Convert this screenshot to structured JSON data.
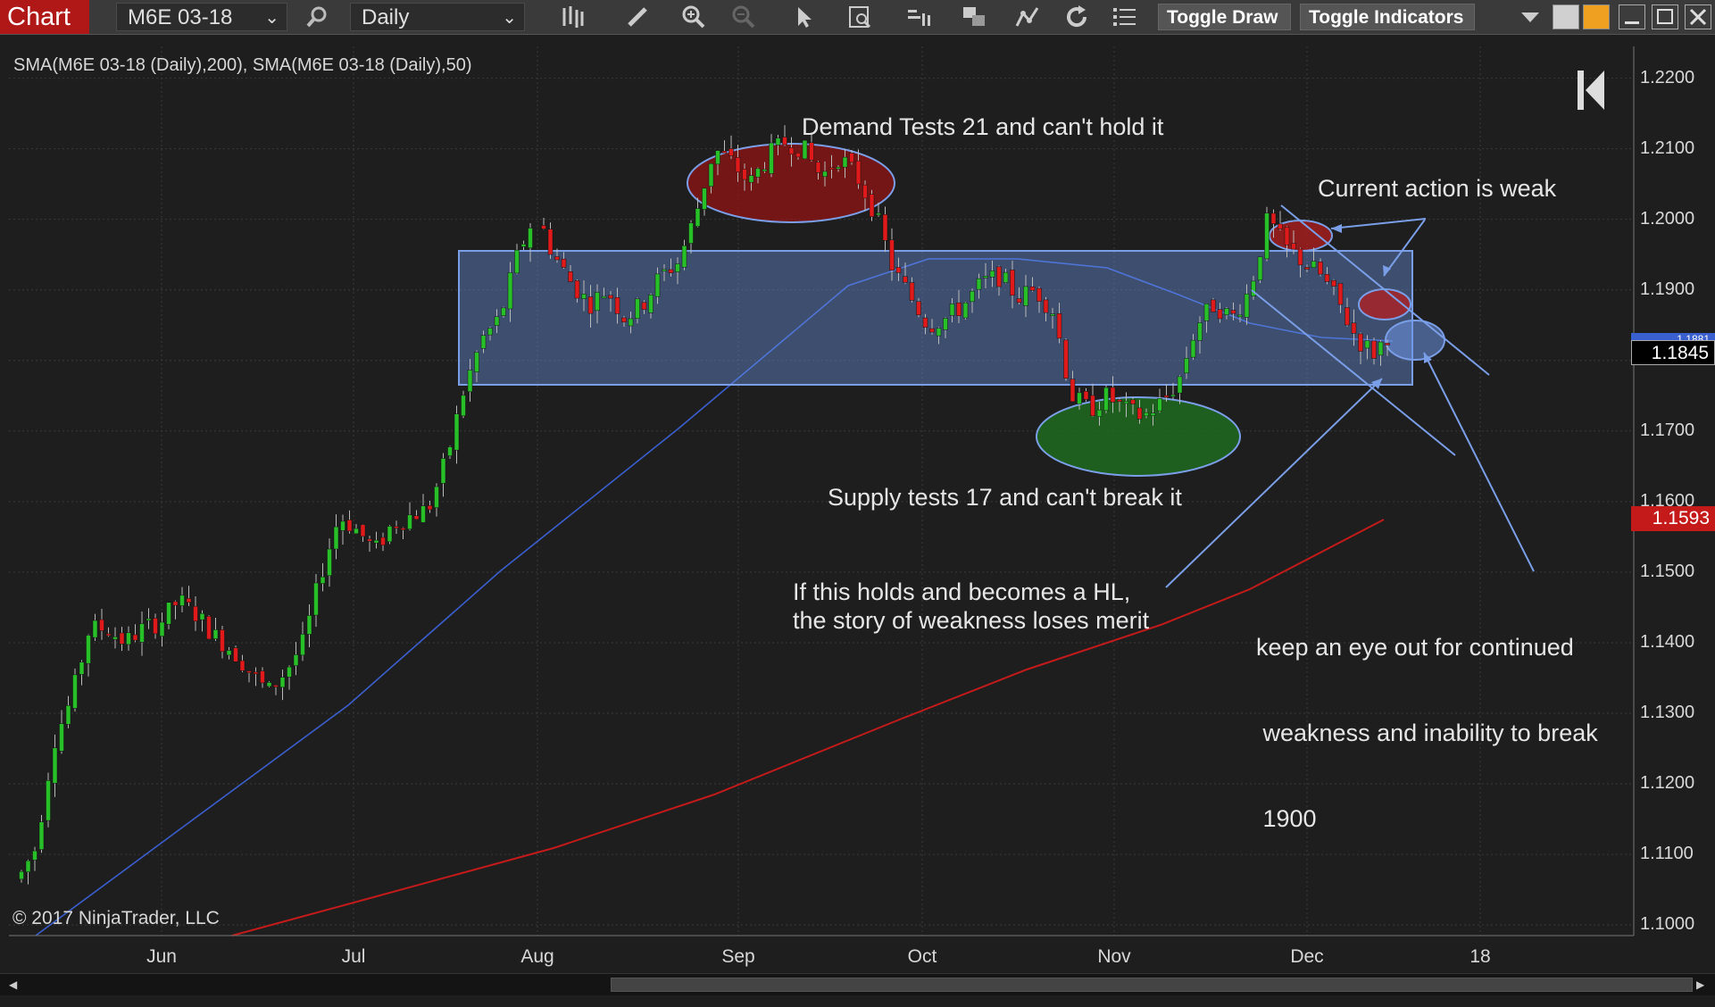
{
  "toolbar": {
    "chart_tab": "Chart",
    "instrument": "M6E 03-18",
    "interval": "Daily",
    "toggle_draw": "Toggle Draw",
    "toggle_indicators": "Toggle Indicators",
    "icons": [
      "bar-type-icon",
      "pencil-icon",
      "zoom-in-icon",
      "zoom-out-icon",
      "pointer-icon",
      "data-box-icon",
      "properties-icon",
      "copy-icon",
      "strategy-icon",
      "refresh-icon",
      "list-icon"
    ]
  },
  "legend": "SMA(M6E 03-18 (Daily),200), SMA(M6E 03-18 (Daily),50)",
  "copyright": "© 2017 NinjaTrader, LLC",
  "annotations": {
    "demand": "Demand Tests 21 and can't hold it",
    "current": "Current action is weak",
    "supply": "Supply tests 17 and can't break it",
    "hl_line1": "If this holds and becomes a HL,",
    "hl_line2": "the story of weakness loses merit",
    "keep_line1": "keep an eye out for continued",
    "keep_line2": " weakness and inability to break",
    "keep_line3": " 1900"
  },
  "price_axis": {
    "labels": [
      "1.2200",
      "1.2100",
      "1.2000",
      "1.1900",
      "1.1800",
      "1.1700",
      "1.1600",
      "1.1500",
      "1.1400",
      "1.1300",
      "1.1200",
      "1.1100",
      "1.1000"
    ],
    "last_price": "1.1845",
    "sma200_value": "1.1593",
    "sma50_value": "1.1881"
  },
  "time_axis": [
    "Jun",
    "Jul",
    "Aug",
    "Sep",
    "Oct",
    "Nov",
    "Dec",
    "18"
  ],
  "colors": {
    "up": "#28c028",
    "down": "#e01a1a",
    "sma50": "#3a5fcf",
    "sma200": "#c41a1a",
    "range_box": "#6688dd",
    "demand_ellipse": "#8b1a1a",
    "supply_ellipse": "#1e6b1e"
  },
  "chart_data": {
    "type": "candlestick",
    "ylim": [
      1.0985,
      1.2245
    ],
    "series": [
      {
        "name": "SMA(M6E 03-18 (Daily),200)"
      },
      {
        "name": "SMA(M6E 03-18 (Daily),50)"
      }
    ]
  }
}
